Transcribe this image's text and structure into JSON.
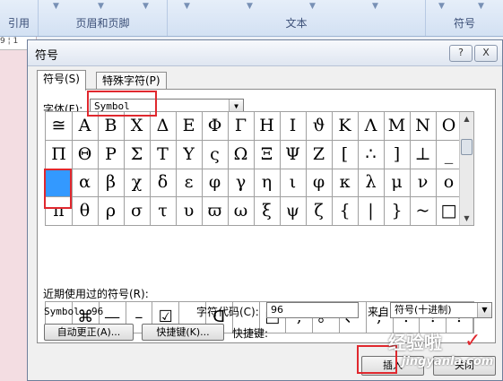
{
  "ribbon": {
    "groups": [
      "引用",
      "页眉和页脚",
      "文本",
      "符号"
    ]
  },
  "ruler": {
    "text": "9 ¦ 1"
  },
  "dialog": {
    "title": "符号",
    "help_label": "?",
    "close_label": "X",
    "tabs": [
      {
        "label": "符号(S)",
        "active": true
      },
      {
        "label": "特殊字符(P)",
        "active": false
      }
    ],
    "font_label": "字体(F):",
    "font_value": "Symbol",
    "symbols": [
      [
        "≅",
        "Α",
        "Β",
        "Χ",
        "Δ",
        "Ε",
        "Φ",
        "Γ",
        "Η",
        "Ι",
        "ϑ",
        "Κ",
        "Λ",
        "Μ",
        "Ν",
        "Ο"
      ],
      [
        "Π",
        "Θ",
        "Ρ",
        "Σ",
        "Τ",
        "Υ",
        "ς",
        "Ω",
        "Ξ",
        "Ψ",
        "Ζ",
        "[",
        "∴",
        "]",
        "⊥",
        "_"
      ],
      [
        "",
        "α",
        "β",
        "χ",
        "δ",
        "ε",
        "φ",
        "γ",
        "η",
        "ι",
        "φ",
        "κ",
        "λ",
        "μ",
        "ν",
        "ο"
      ],
      [
        "π",
        "θ",
        "ρ",
        "σ",
        "τ",
        "υ",
        "ϖ",
        "ω",
        "ξ",
        "ψ",
        "ζ",
        "{",
        "|",
        "}",
        "~",
        "□"
      ]
    ],
    "selected_cell": [
      2,
      0
    ],
    "recent_label": "近期使用过的符号(R):",
    "recent_symbols": [
      "",
      "⌘",
      "—",
      "–",
      "☑",
      "",
      "ᗡ",
      "",
      "□",
      ",",
      "。",
      "、",
      ";",
      ":",
      "!",
      "?"
    ],
    "char_name": "Symbol: 96",
    "char_code_label": "字符代码(C):",
    "char_code_value": "96",
    "from_label": "来自(M):",
    "from_value": "符号(十进制)",
    "autocorrect_button": "自动更正(A)...",
    "shortcut_button": "快捷键(K)...",
    "shortcut_label": "快捷键:",
    "insert_button": "插入",
    "cancel_button": "关闭"
  },
  "watermark": {
    "line1": "经验啦",
    "line2": "jingyanla.com"
  }
}
